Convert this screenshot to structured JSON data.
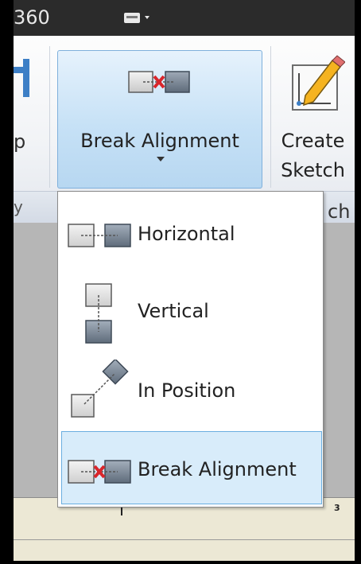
{
  "title_bar": {
    "title": "360",
    "qat_icon": "folder-dropdown-icon"
  },
  "ribbon": {
    "partial_left_label": "p",
    "partial_left_panel": "y",
    "break_alignment_button": {
      "label": "Break Alignment",
      "icon": "break-alignment-icon",
      "dropdown_icon": "chevron-down-icon"
    },
    "create_sketch_button": {
      "label_line1": "Create",
      "label_line2": "Sketch",
      "icon": "create-sketch-icon"
    },
    "right_panel_label": "ch"
  },
  "dropdown": {
    "items": [
      {
        "label": "Horizontal",
        "icon": "horizontal-align-icon",
        "highlighted": false
      },
      {
        "label": "Vertical",
        "icon": "vertical-align-icon",
        "highlighted": false
      },
      {
        "label": "In Position",
        "icon": "in-position-align-icon",
        "highlighted": false
      },
      {
        "label": "Break Alignment",
        "icon": "break-alignment-icon",
        "highlighted": true
      }
    ]
  },
  "ruler": {
    "number": "3"
  },
  "colors": {
    "accent_blue": "#7fb0dc",
    "highlight_fill": "#d8ecfa",
    "break_mark_red": "#d8262b",
    "title_bar": "#2b2b2b"
  }
}
